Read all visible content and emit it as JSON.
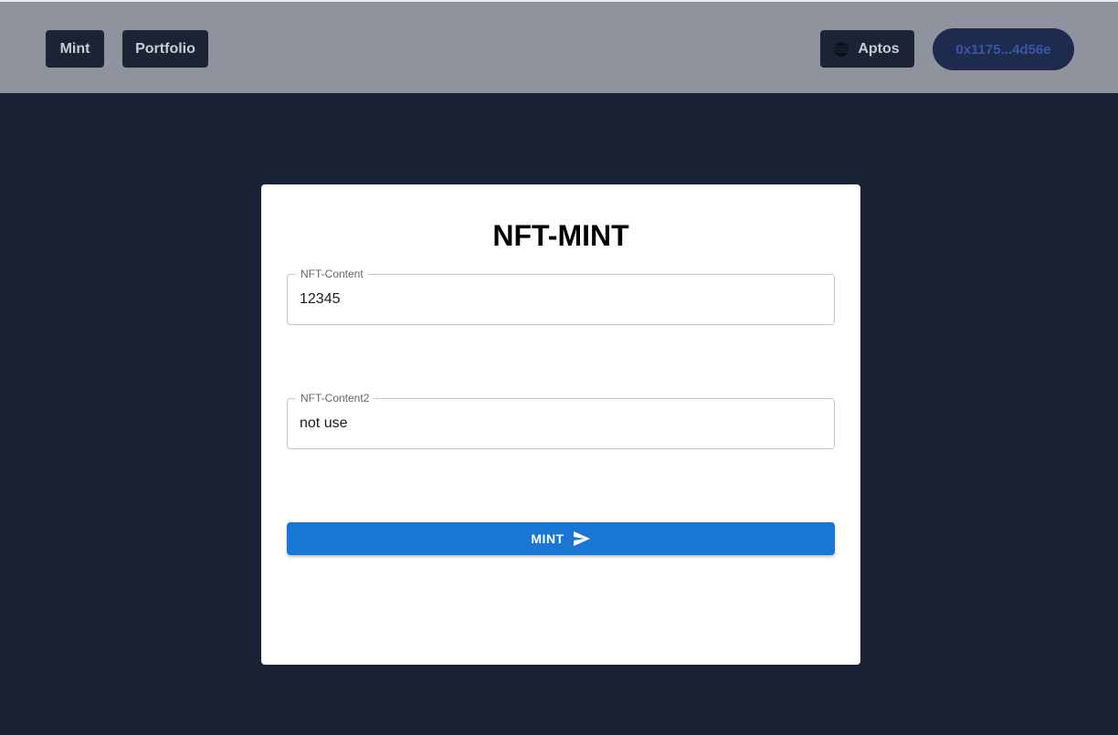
{
  "header": {
    "nav": [
      {
        "label": "Mint"
      },
      {
        "label": "Portfolio"
      }
    ],
    "network": {
      "label": "Aptos",
      "icon": "aptos-network-icon"
    },
    "wallet": {
      "address": "0x1175...4d56e"
    }
  },
  "form": {
    "title": "NFT-MINT",
    "fields": [
      {
        "label": "NFT-Content",
        "value": "12345"
      },
      {
        "label": "NFT-Content2",
        "value": "not use"
      }
    ],
    "submit": {
      "label": "MINT",
      "icon": "send-icon"
    }
  },
  "colors": {
    "page_background": "#1a2235",
    "header_background": "#8f939e",
    "nav_button": "#1b2334",
    "wallet_button": "#1e2b4f",
    "wallet_text": "#3a56a8",
    "primary": "#1976d2"
  }
}
